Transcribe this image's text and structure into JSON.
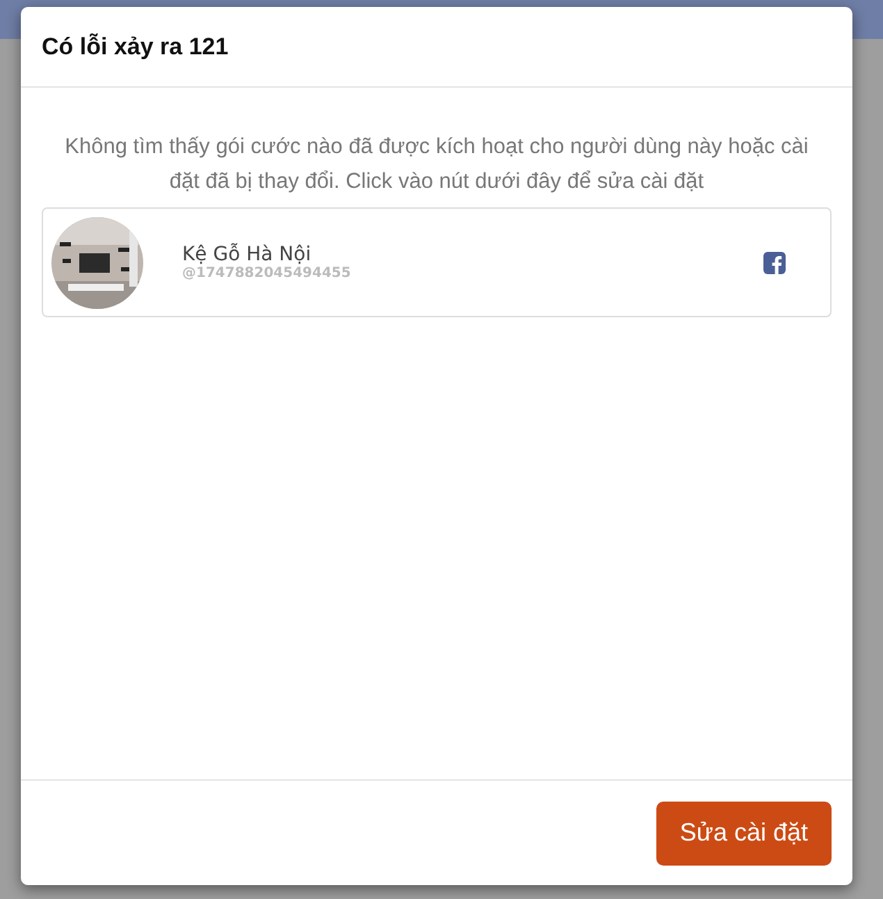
{
  "dialog": {
    "title": "Có lỗi xảy ra 121",
    "message": "Không tìm thấy gói cước nào đã được kích hoạt cho người dùng này hoặc cài đặt đã bị thay đổi. Click vào nút dưới đây để sửa cài đặt",
    "account": {
      "name": "Kệ Gỗ Hà Nội",
      "handle": "@1747882045494455"
    },
    "buttons": [
      "Sửa cài đặt"
    ]
  }
}
